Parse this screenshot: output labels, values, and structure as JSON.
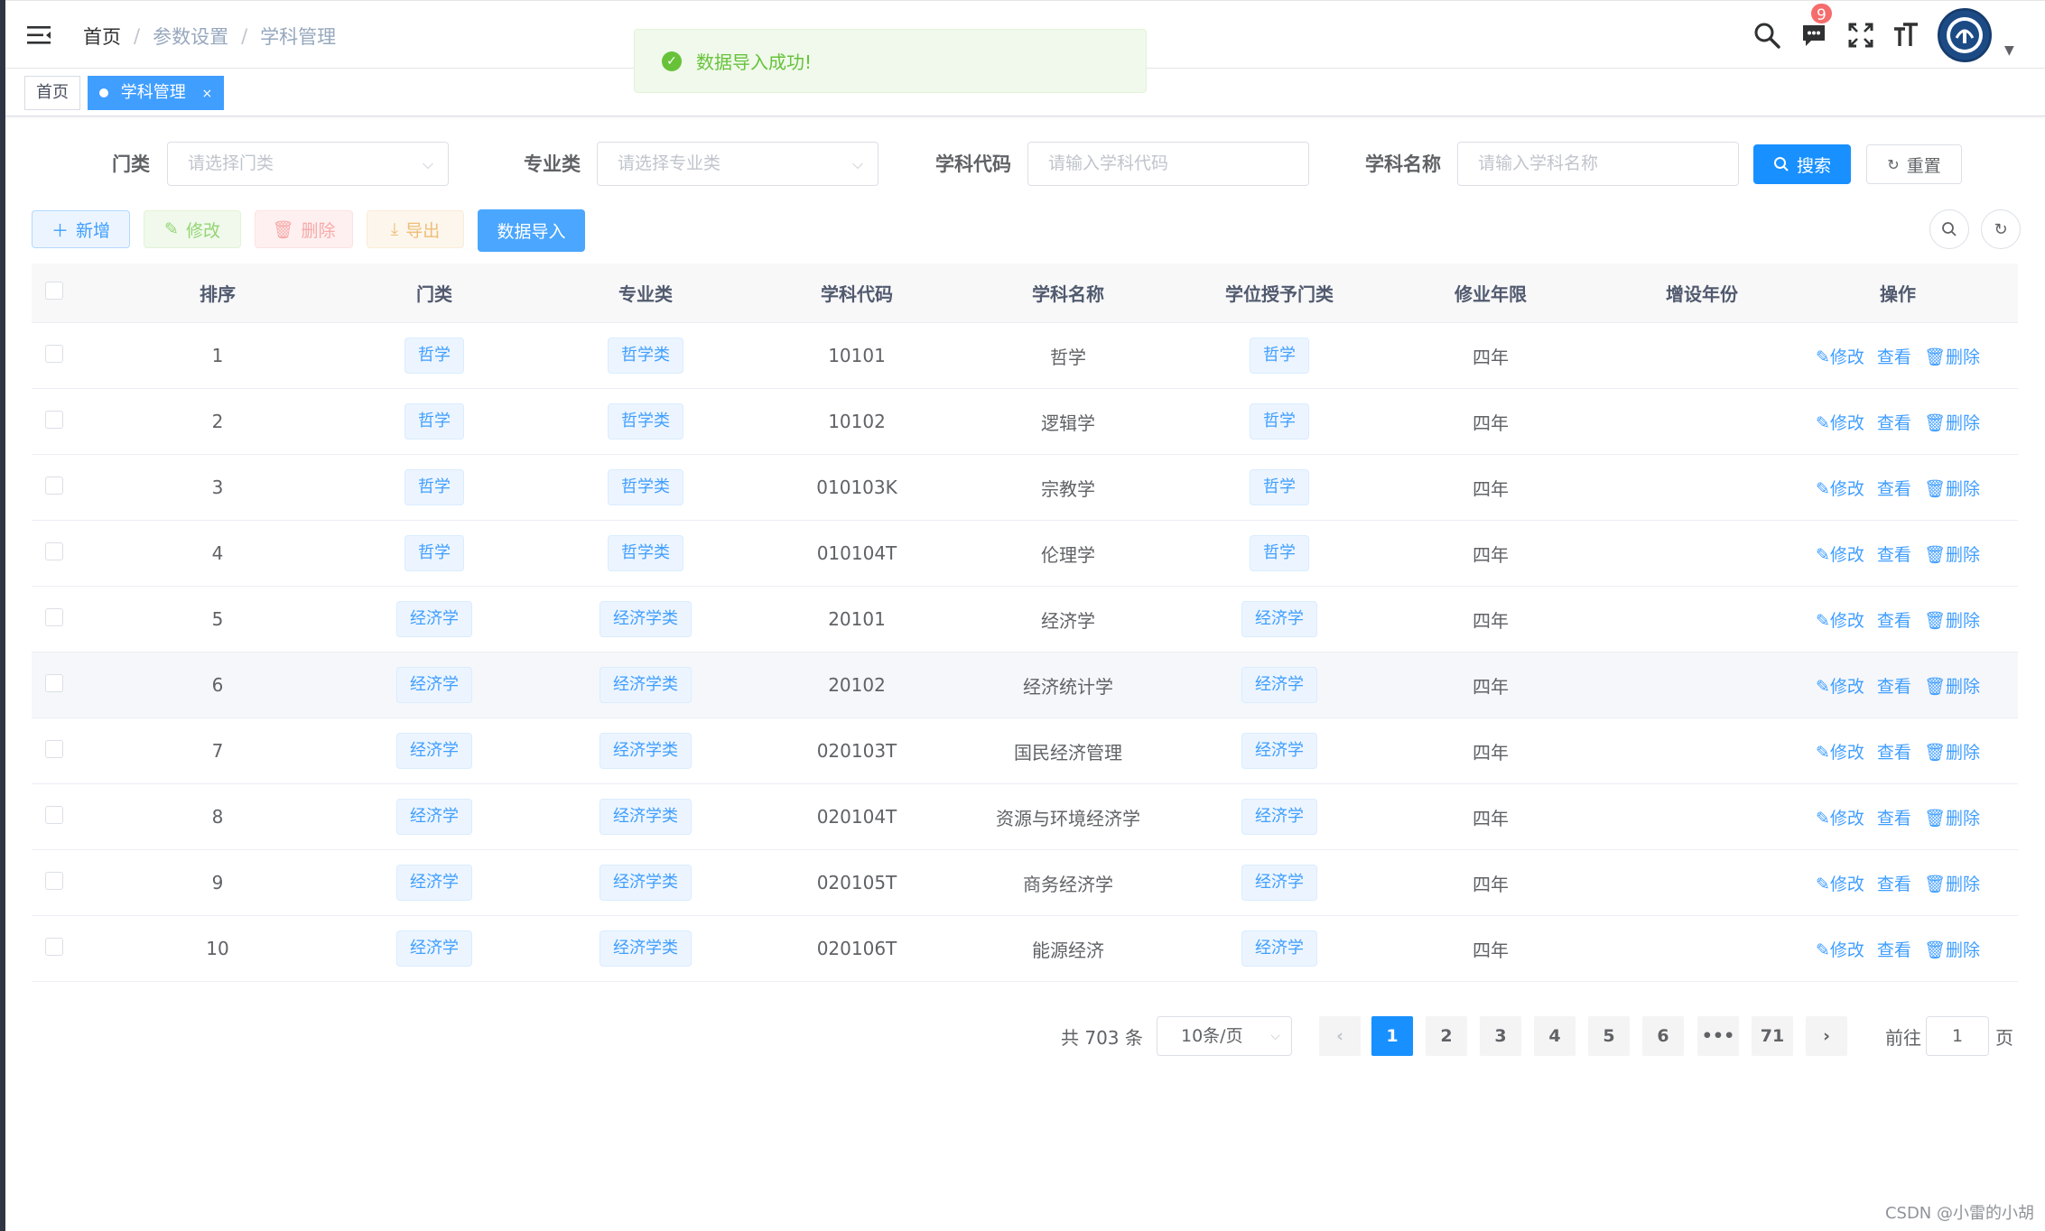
{
  "breadcrumb": [
    "首页",
    "参数设置",
    "学科管理"
  ],
  "notifications": {
    "count": "9"
  },
  "tags": {
    "home": "首页",
    "active": "学科管理",
    "close": "×"
  },
  "message": {
    "text": "数据导入成功!"
  },
  "search": {
    "menlei_label": "门类",
    "menlei_placeholder": "请选择门类",
    "zhuanye_label": "专业类",
    "zhuanye_placeholder": "请选择专业类",
    "code_label": "学科代码",
    "code_placeholder": "请输入学科代码",
    "name_label": "学科名称",
    "name_placeholder": "请输入学科名称",
    "search_button": "搜索",
    "reset_button": "重置"
  },
  "toolbar": {
    "add": "新增",
    "edit": "修改",
    "delete": "删除",
    "export": "导出",
    "import": "数据导入"
  },
  "table": {
    "headers": [
      "排序",
      "门类",
      "专业类",
      "学科代码",
      "学科名称",
      "学位授予门类",
      "修业年限",
      "增设年份",
      "操作"
    ],
    "ops": {
      "edit": "修改",
      "view": "查看",
      "delete": "删除"
    },
    "rows": [
      {
        "sort": "1",
        "menlei": "哲学",
        "zhuanye": "哲学类",
        "code": "10101",
        "name": "哲学",
        "degree": "哲学",
        "years": "四年",
        "added": ""
      },
      {
        "sort": "2",
        "menlei": "哲学",
        "zhuanye": "哲学类",
        "code": "10102",
        "name": "逻辑学",
        "degree": "哲学",
        "years": "四年",
        "added": ""
      },
      {
        "sort": "3",
        "menlei": "哲学",
        "zhuanye": "哲学类",
        "code": "010103K",
        "name": "宗教学",
        "degree": "哲学",
        "years": "四年",
        "added": ""
      },
      {
        "sort": "4",
        "menlei": "哲学",
        "zhuanye": "哲学类",
        "code": "010104T",
        "name": "伦理学",
        "degree": "哲学",
        "years": "四年",
        "added": ""
      },
      {
        "sort": "5",
        "menlei": "经济学",
        "zhuanye": "经济学类",
        "code": "20101",
        "name": "经济学",
        "degree": "经济学",
        "years": "四年",
        "added": ""
      },
      {
        "sort": "6",
        "menlei": "经济学",
        "zhuanye": "经济学类",
        "code": "20102",
        "name": "经济统计学",
        "degree": "经济学",
        "years": "四年",
        "added": ""
      },
      {
        "sort": "7",
        "menlei": "经济学",
        "zhuanye": "经济学类",
        "code": "020103T",
        "name": "国民经济管理",
        "degree": "经济学",
        "years": "四年",
        "added": ""
      },
      {
        "sort": "8",
        "menlei": "经济学",
        "zhuanye": "经济学类",
        "code": "020104T",
        "name": "资源与环境经济学",
        "degree": "经济学",
        "years": "四年",
        "added": ""
      },
      {
        "sort": "9",
        "menlei": "经济学",
        "zhuanye": "经济学类",
        "code": "020105T",
        "name": "商务经济学",
        "degree": "经济学",
        "years": "四年",
        "added": ""
      },
      {
        "sort": "10",
        "menlei": "经济学",
        "zhuanye": "经济学类",
        "code": "020106T",
        "name": "能源经济",
        "degree": "经济学",
        "years": "四年",
        "added": ""
      }
    ]
  },
  "pagination": {
    "total": "共 703 条",
    "page_size": "10条/页",
    "pages": [
      "1",
      "2",
      "3",
      "4",
      "5",
      "6",
      "•••",
      "71"
    ],
    "current": "1",
    "goto_label": "前往",
    "goto_value": "1",
    "goto_suffix": "页"
  },
  "watermark": "CSDN @小雷的小胡",
  "colors": {
    "primary": "#1890ff",
    "success": "#67c23a",
    "danger": "#f56c6c"
  }
}
